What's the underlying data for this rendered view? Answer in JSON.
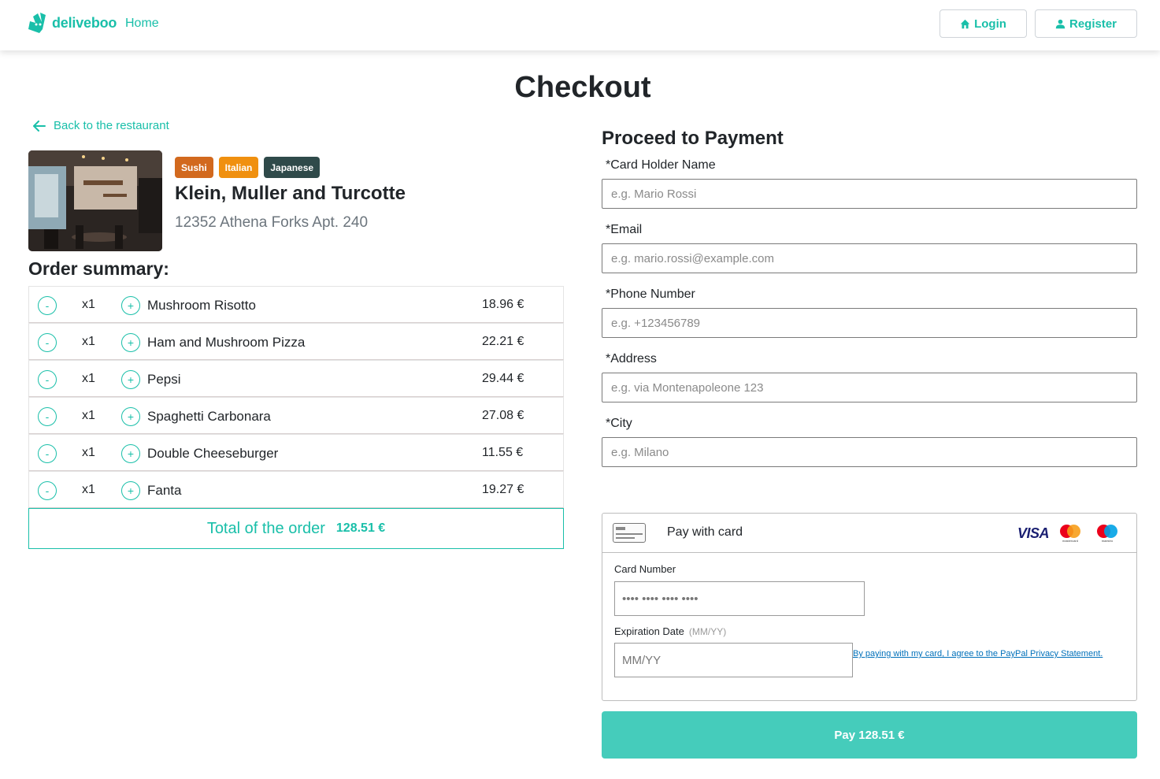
{
  "navbar": {
    "brand": "deliveboo",
    "home": "Home",
    "login": "Login",
    "register": "Register"
  },
  "page_title": "Checkout",
  "back_link": "Back to the restaurant",
  "restaurant": {
    "tags": [
      {
        "label": "Sushi",
        "color": "#d2691e"
      },
      {
        "label": "Italian",
        "color": "#f0900f"
      },
      {
        "label": "Japanese",
        "color": "#2f4a4a"
      }
    ],
    "name": "Klein, Muller and Turcotte",
    "address": "12352 Athena Forks Apt. 240"
  },
  "order": {
    "heading": "Order summary:",
    "items": [
      {
        "qty": "x1",
        "name": "Mushroom Risotto",
        "price": "18.96 €"
      },
      {
        "qty": "x1",
        "name": "Ham and Mushroom Pizza",
        "price": "22.21 €"
      },
      {
        "qty": "x1",
        "name": "Pepsi",
        "price": "29.44 €"
      },
      {
        "qty": "x1",
        "name": "Spaghetti Carbonara",
        "price": "27.08 €"
      },
      {
        "qty": "x1",
        "name": "Double Cheeseburger",
        "price": "11.55 €"
      },
      {
        "qty": "x1",
        "name": "Fanta",
        "price": "19.27 €"
      }
    ],
    "minus_symbol": "-",
    "plus_symbol": "+",
    "total_label": "Total of the order",
    "total_value": "128.51 €"
  },
  "payment": {
    "heading": "Proceed to Payment",
    "fields": {
      "holder": {
        "label": "*Card Holder Name",
        "placeholder": "e.g. Mario Rossi"
      },
      "email": {
        "label": "*Email",
        "placeholder": "e.g. mario.rossi@example.com"
      },
      "phone": {
        "label": "*Phone Number",
        "placeholder": "e.g. +123456789"
      },
      "address": {
        "label": "*Address",
        "placeholder": "e.g. via Montenapoleone 123"
      },
      "city": {
        "label": "*City",
        "placeholder": "e.g. Milano"
      }
    },
    "card": {
      "title": "Pay with card",
      "brands": {
        "visa": "VISA",
        "mastercard": "mastercard",
        "maestro": "maestro"
      },
      "number_label": "Card Number",
      "number_placeholder": "•••• •••• •••• ••••",
      "expiry_label": "Expiration Date",
      "expiry_hint": "(MM/YY)",
      "expiry_placeholder": "MM/YY",
      "paypal_statement": "By paying with my card, I agree to the PayPal Privacy Statement."
    },
    "pay_button": "Pay 128.51 €"
  },
  "colors": {
    "accent": "#19bfa9",
    "pay_button": "#45ccbb"
  }
}
